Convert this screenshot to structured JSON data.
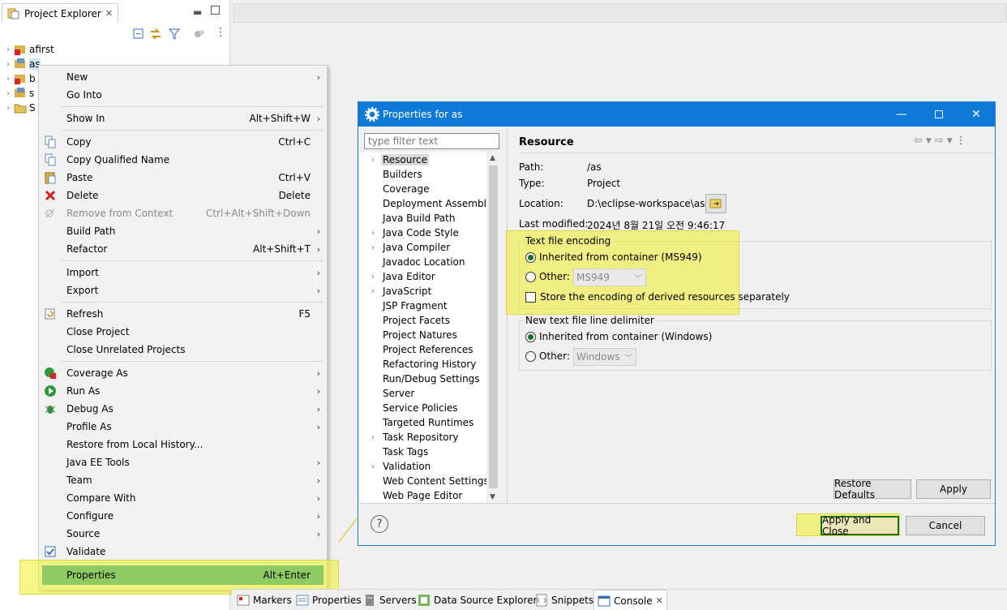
{
  "project_explorer": {
    "tab_label": "Project Explorer",
    "items": [
      {
        "label": "afirst"
      },
      {
        "label": "as"
      },
      {
        "label": "b"
      },
      {
        "label": "s"
      },
      {
        "label": "S"
      }
    ]
  },
  "context_menu": {
    "items": [
      {
        "label": "New",
        "shortcut": "",
        "submenu": true
      },
      {
        "label": "Go Into",
        "shortcut": ""
      },
      {
        "label": "Show In",
        "shortcut": "Alt+Shift+W",
        "submenu": true
      },
      {
        "label": "Copy",
        "shortcut": "Ctrl+C"
      },
      {
        "label": "Copy Qualified Name",
        "shortcut": ""
      },
      {
        "label": "Paste",
        "shortcut": "Ctrl+V"
      },
      {
        "label": "Delete",
        "shortcut": "Delete"
      },
      {
        "label": "Remove from Context",
        "shortcut": "Ctrl+Alt+Shift+Down"
      },
      {
        "label": "Build Path",
        "shortcut": "",
        "submenu": true
      },
      {
        "label": "Refactor",
        "shortcut": "Alt+Shift+T",
        "submenu": true
      },
      {
        "label": "Import",
        "shortcut": "",
        "submenu": true
      },
      {
        "label": "Export",
        "shortcut": "",
        "submenu": true
      },
      {
        "label": "Refresh",
        "shortcut": "F5"
      },
      {
        "label": "Close Project",
        "shortcut": ""
      },
      {
        "label": "Close Unrelated Projects",
        "shortcut": ""
      },
      {
        "label": "Coverage As",
        "shortcut": "",
        "submenu": true
      },
      {
        "label": "Run As",
        "shortcut": "",
        "submenu": true
      },
      {
        "label": "Debug As",
        "shortcut": "",
        "submenu": true
      },
      {
        "label": "Profile As",
        "shortcut": "",
        "submenu": true
      },
      {
        "label": "Restore from Local History...",
        "shortcut": ""
      },
      {
        "label": "Java EE Tools",
        "shortcut": "",
        "submenu": true
      },
      {
        "label": "Team",
        "shortcut": "",
        "submenu": true
      },
      {
        "label": "Compare With",
        "shortcut": "",
        "submenu": true
      },
      {
        "label": "Configure",
        "shortcut": "",
        "submenu": true
      },
      {
        "label": "Source",
        "shortcut": "",
        "submenu": true
      },
      {
        "label": "Validate",
        "shortcut": ""
      },
      {
        "label": "Properties",
        "shortcut": "Alt+Enter"
      }
    ],
    "submenu_arrow": "›"
  },
  "dialog": {
    "title": "Properties for as",
    "filter_placeholder": "type filter text",
    "nav_items": [
      {
        "label": "Resource",
        "expandable": true
      },
      {
        "label": "Builders",
        "expandable": false
      },
      {
        "label": "Coverage",
        "expandable": false
      },
      {
        "label": "Deployment Assembly",
        "expandable": false
      },
      {
        "label": "Java Build Path",
        "expandable": false
      },
      {
        "label": "Java Code Style",
        "expandable": true
      },
      {
        "label": "Java Compiler",
        "expandable": true
      },
      {
        "label": "Javadoc Location",
        "expandable": false
      },
      {
        "label": "Java Editor",
        "expandable": true
      },
      {
        "label": "JavaScript",
        "expandable": true
      },
      {
        "label": "JSP Fragment",
        "expandable": false
      },
      {
        "label": "Project Facets",
        "expandable": false
      },
      {
        "label": "Project Natures",
        "expandable": false
      },
      {
        "label": "Project References",
        "expandable": false
      },
      {
        "label": "Refactoring History",
        "expandable": false
      },
      {
        "label": "Run/Debug Settings",
        "expandable": false
      },
      {
        "label": "Server",
        "expandable": false
      },
      {
        "label": "Service Policies",
        "expandable": false
      },
      {
        "label": "Targeted Runtimes",
        "expandable": false
      },
      {
        "label": "Task Repository",
        "expandable": true
      },
      {
        "label": "Task Tags",
        "expandable": false
      },
      {
        "label": "Validation",
        "expandable": true
      },
      {
        "label": "Web Content Settings",
        "expandable": false
      },
      {
        "label": "Web Page Editor",
        "expandable": false
      }
    ],
    "resource": {
      "title": "Resource",
      "path_label": "Path:",
      "path_value": "/as",
      "type_label": "Type:",
      "type_value": "Project",
      "location_label": "Location:",
      "location_value": "D:\\eclipse-workspace\\as",
      "modified_label": "Last modified:",
      "modified_value": "2024년 8월 21일 오전 9:46:17",
      "encoding_group": "Text file encoding",
      "encoding_inherited": "Inherited from container (MS949)",
      "encoding_other": "Other:",
      "encoding_other_value": "MS949",
      "encoding_store": "Store the encoding of derived resources separately",
      "delim_group": "New text file line delimiter",
      "delim_inherited": "Inherited from container (Windows)",
      "delim_other": "Other:",
      "delim_other_value": "Windows"
    },
    "buttons": {
      "restore_defaults": "Restore Defaults",
      "apply": "Apply",
      "apply_and_close": "Apply and Close",
      "cancel": "Cancel"
    }
  },
  "bottom_tabs": [
    {
      "label": "Markers"
    },
    {
      "label": "Properties"
    },
    {
      "label": "Servers"
    },
    {
      "label": "Data Source Explorer"
    },
    {
      "label": "Snippets"
    },
    {
      "label": "Console"
    }
  ],
  "colors": {
    "title_bar": "#0f79d7",
    "highlight": "#f0f028",
    "menu_selected": "#8fca62",
    "arrow": "#e8c23a"
  }
}
